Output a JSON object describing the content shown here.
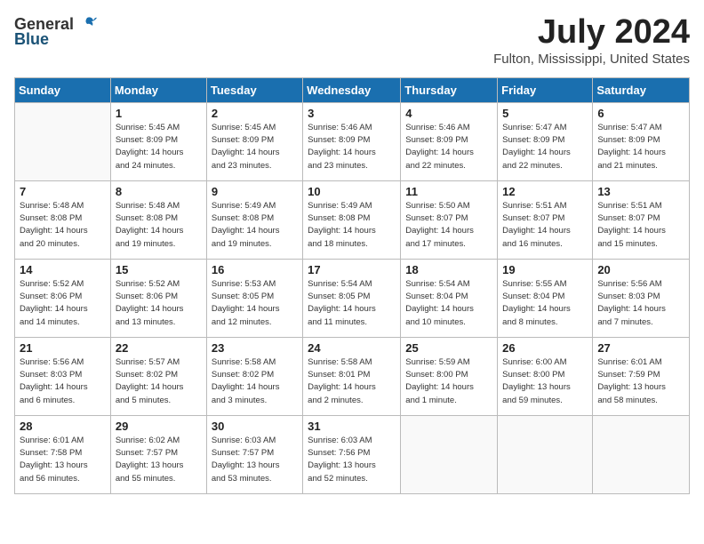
{
  "logo": {
    "general": "General",
    "blue": "Blue"
  },
  "title": {
    "month_year": "July 2024",
    "location": "Fulton, Mississippi, United States"
  },
  "headers": [
    "Sunday",
    "Monday",
    "Tuesday",
    "Wednesday",
    "Thursday",
    "Friday",
    "Saturday"
  ],
  "weeks": [
    [
      {
        "day": "",
        "info": ""
      },
      {
        "day": "1",
        "info": "Sunrise: 5:45 AM\nSunset: 8:09 PM\nDaylight: 14 hours\nand 24 minutes."
      },
      {
        "day": "2",
        "info": "Sunrise: 5:45 AM\nSunset: 8:09 PM\nDaylight: 14 hours\nand 23 minutes."
      },
      {
        "day": "3",
        "info": "Sunrise: 5:46 AM\nSunset: 8:09 PM\nDaylight: 14 hours\nand 23 minutes."
      },
      {
        "day": "4",
        "info": "Sunrise: 5:46 AM\nSunset: 8:09 PM\nDaylight: 14 hours\nand 22 minutes."
      },
      {
        "day": "5",
        "info": "Sunrise: 5:47 AM\nSunset: 8:09 PM\nDaylight: 14 hours\nand 22 minutes."
      },
      {
        "day": "6",
        "info": "Sunrise: 5:47 AM\nSunset: 8:09 PM\nDaylight: 14 hours\nand 21 minutes."
      }
    ],
    [
      {
        "day": "7",
        "info": "Sunrise: 5:48 AM\nSunset: 8:08 PM\nDaylight: 14 hours\nand 20 minutes."
      },
      {
        "day": "8",
        "info": "Sunrise: 5:48 AM\nSunset: 8:08 PM\nDaylight: 14 hours\nand 19 minutes."
      },
      {
        "day": "9",
        "info": "Sunrise: 5:49 AM\nSunset: 8:08 PM\nDaylight: 14 hours\nand 19 minutes."
      },
      {
        "day": "10",
        "info": "Sunrise: 5:49 AM\nSunset: 8:08 PM\nDaylight: 14 hours\nand 18 minutes."
      },
      {
        "day": "11",
        "info": "Sunrise: 5:50 AM\nSunset: 8:07 PM\nDaylight: 14 hours\nand 17 minutes."
      },
      {
        "day": "12",
        "info": "Sunrise: 5:51 AM\nSunset: 8:07 PM\nDaylight: 14 hours\nand 16 minutes."
      },
      {
        "day": "13",
        "info": "Sunrise: 5:51 AM\nSunset: 8:07 PM\nDaylight: 14 hours\nand 15 minutes."
      }
    ],
    [
      {
        "day": "14",
        "info": "Sunrise: 5:52 AM\nSunset: 8:06 PM\nDaylight: 14 hours\nand 14 minutes."
      },
      {
        "day": "15",
        "info": "Sunrise: 5:52 AM\nSunset: 8:06 PM\nDaylight: 14 hours\nand 13 minutes."
      },
      {
        "day": "16",
        "info": "Sunrise: 5:53 AM\nSunset: 8:05 PM\nDaylight: 14 hours\nand 12 minutes."
      },
      {
        "day": "17",
        "info": "Sunrise: 5:54 AM\nSunset: 8:05 PM\nDaylight: 14 hours\nand 11 minutes."
      },
      {
        "day": "18",
        "info": "Sunrise: 5:54 AM\nSunset: 8:04 PM\nDaylight: 14 hours\nand 10 minutes."
      },
      {
        "day": "19",
        "info": "Sunrise: 5:55 AM\nSunset: 8:04 PM\nDaylight: 14 hours\nand 8 minutes."
      },
      {
        "day": "20",
        "info": "Sunrise: 5:56 AM\nSunset: 8:03 PM\nDaylight: 14 hours\nand 7 minutes."
      }
    ],
    [
      {
        "day": "21",
        "info": "Sunrise: 5:56 AM\nSunset: 8:03 PM\nDaylight: 14 hours\nand 6 minutes."
      },
      {
        "day": "22",
        "info": "Sunrise: 5:57 AM\nSunset: 8:02 PM\nDaylight: 14 hours\nand 5 minutes."
      },
      {
        "day": "23",
        "info": "Sunrise: 5:58 AM\nSunset: 8:02 PM\nDaylight: 14 hours\nand 3 minutes."
      },
      {
        "day": "24",
        "info": "Sunrise: 5:58 AM\nSunset: 8:01 PM\nDaylight: 14 hours\nand 2 minutes."
      },
      {
        "day": "25",
        "info": "Sunrise: 5:59 AM\nSunset: 8:00 PM\nDaylight: 14 hours\nand 1 minute."
      },
      {
        "day": "26",
        "info": "Sunrise: 6:00 AM\nSunset: 8:00 PM\nDaylight: 13 hours\nand 59 minutes."
      },
      {
        "day": "27",
        "info": "Sunrise: 6:01 AM\nSunset: 7:59 PM\nDaylight: 13 hours\nand 58 minutes."
      }
    ],
    [
      {
        "day": "28",
        "info": "Sunrise: 6:01 AM\nSunset: 7:58 PM\nDaylight: 13 hours\nand 56 minutes."
      },
      {
        "day": "29",
        "info": "Sunrise: 6:02 AM\nSunset: 7:57 PM\nDaylight: 13 hours\nand 55 minutes."
      },
      {
        "day": "30",
        "info": "Sunrise: 6:03 AM\nSunset: 7:57 PM\nDaylight: 13 hours\nand 53 minutes."
      },
      {
        "day": "31",
        "info": "Sunrise: 6:03 AM\nSunset: 7:56 PM\nDaylight: 13 hours\nand 52 minutes."
      },
      {
        "day": "",
        "info": ""
      },
      {
        "day": "",
        "info": ""
      },
      {
        "day": "",
        "info": ""
      }
    ]
  ]
}
